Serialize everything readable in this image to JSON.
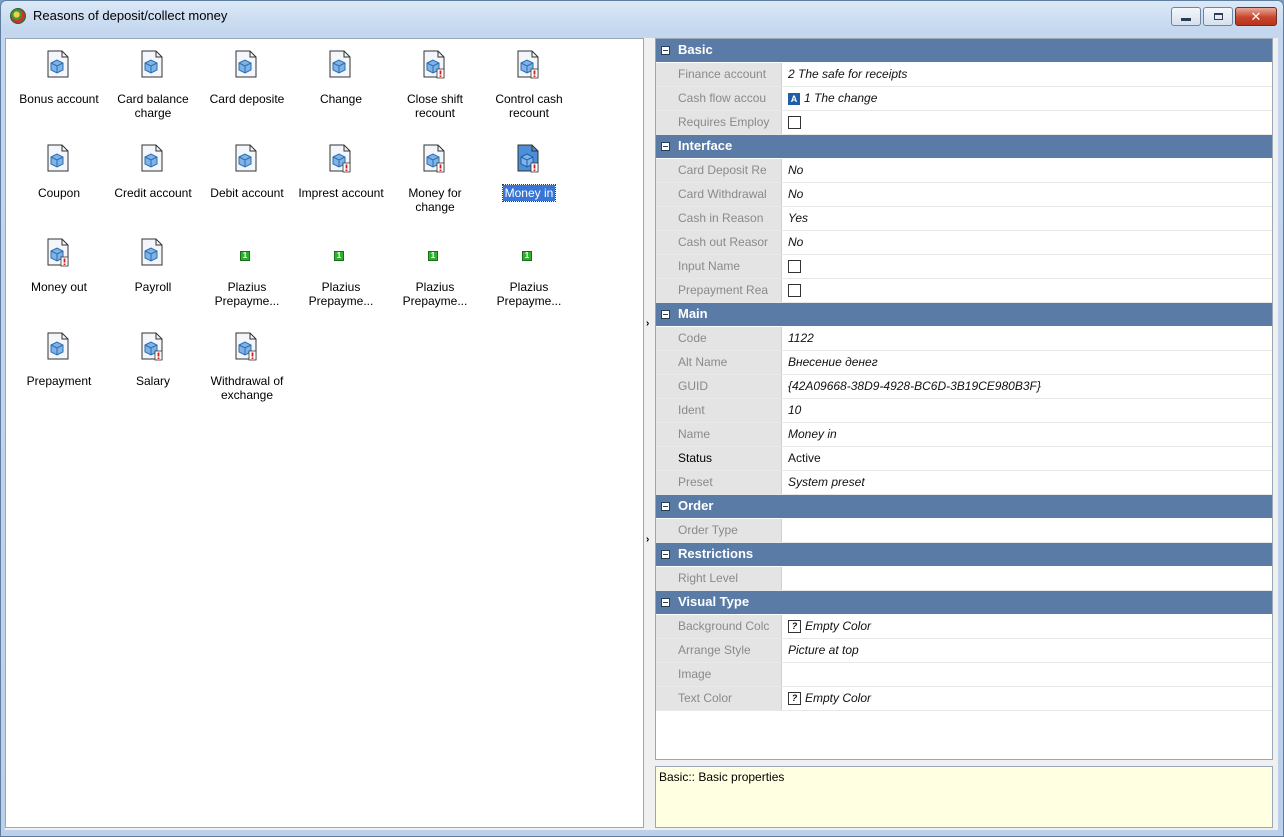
{
  "window": {
    "title": "Reasons of deposit/collect money",
    "controls": {
      "minimize": "minimize",
      "maximize": "maximize",
      "close": "✕"
    }
  },
  "reasons": [
    {
      "label": "Bonus account",
      "icon": "document-icon"
    },
    {
      "label": "Card balance charge",
      "icon": "document-icon"
    },
    {
      "label": "Card deposite",
      "icon": "document-icon"
    },
    {
      "label": "Change",
      "icon": "document-icon"
    },
    {
      "label": "Close shift recount",
      "icon": "document-flag-icon"
    },
    {
      "label": "Control cash recount",
      "icon": "document-flag-icon"
    },
    {
      "label": "Coupon",
      "icon": "document-icon"
    },
    {
      "label": "Credit account",
      "icon": "document-icon"
    },
    {
      "label": "Debit account",
      "icon": "document-icon"
    },
    {
      "label": "Imprest account",
      "icon": "document-flag-icon"
    },
    {
      "label": "Money for change",
      "icon": "document-flag-icon"
    },
    {
      "label": "Money in",
      "icon": "document-flag-icon",
      "selected": true
    },
    {
      "label": "Money out",
      "icon": "document-flag-icon"
    },
    {
      "label": "Payroll",
      "icon": "document-icon"
    },
    {
      "label": "Plazius Prepayme...",
      "icon": "small-green-icon"
    },
    {
      "label": "Plazius Prepayme...",
      "icon": "small-green-icon"
    },
    {
      "label": "Plazius Prepayme...",
      "icon": "small-green-icon"
    },
    {
      "label": "Plazius Prepayme...",
      "icon": "small-green-icon"
    },
    {
      "label": "Prepayment",
      "icon": "document-icon"
    },
    {
      "label": "Salary",
      "icon": "document-flag-icon"
    },
    {
      "label": "Withdrawal of exchange",
      "icon": "document-flag-icon"
    }
  ],
  "properties": {
    "basic": {
      "title": "Basic",
      "finance_account": {
        "name": "Finance account",
        "value": "2 The safe for receipts"
      },
      "cash_flow": {
        "name": "Cash flow accou",
        "badge": "A",
        "value": "1 The change"
      },
      "requires_employee": {
        "name": "Requires Employ"
      }
    },
    "interface": {
      "title": "Interface",
      "card_deposit": {
        "name": "Card Deposit Re",
        "value": "No"
      },
      "card_withdrawal": {
        "name": "Card Withdrawal",
        "value": "No"
      },
      "cash_in": {
        "name": "Cash in Reason",
        "value": "Yes"
      },
      "cash_out": {
        "name": "Cash out Reasor",
        "value": "No"
      },
      "input_name": {
        "name": "Input Name"
      },
      "prepayment": {
        "name": "Prepayment Rea"
      }
    },
    "main": {
      "title": "Main",
      "code": {
        "name": "Code",
        "value": "1122"
      },
      "alt_name": {
        "name": "Alt Name",
        "value": "Внесение денег"
      },
      "guid": {
        "name": "GUID",
        "value": "{42A09668-38D9-4928-BC6D-3B19CE980B3F}"
      },
      "ident": {
        "name": "Ident",
        "value": "10"
      },
      "name": {
        "name": "Name",
        "value": "Money in"
      },
      "status": {
        "name": "Status",
        "value": "Active"
      },
      "preset": {
        "name": "Preset",
        "value": "System preset"
      }
    },
    "order": {
      "title": "Order",
      "order_type": {
        "name": "Order Type",
        "value": ""
      }
    },
    "restrictions": {
      "title": "Restrictions",
      "right_level": {
        "name": "Right Level",
        "value": ""
      }
    },
    "visual": {
      "title": "Visual Type",
      "background": {
        "name": "Background Colc",
        "badge": "?",
        "value": "Empty Color"
      },
      "arrange": {
        "name": "Arrange Style",
        "value": "Picture at top"
      },
      "image": {
        "name": "Image",
        "value": ""
      },
      "text_color": {
        "name": "Text Color",
        "badge": "?",
        "value": "Empty Color"
      }
    }
  },
  "description": "Basic:: Basic properties",
  "colors": {
    "category_header": "#5a7ba6",
    "selection": "#3875d7",
    "description_bg": "#ffffe1"
  }
}
